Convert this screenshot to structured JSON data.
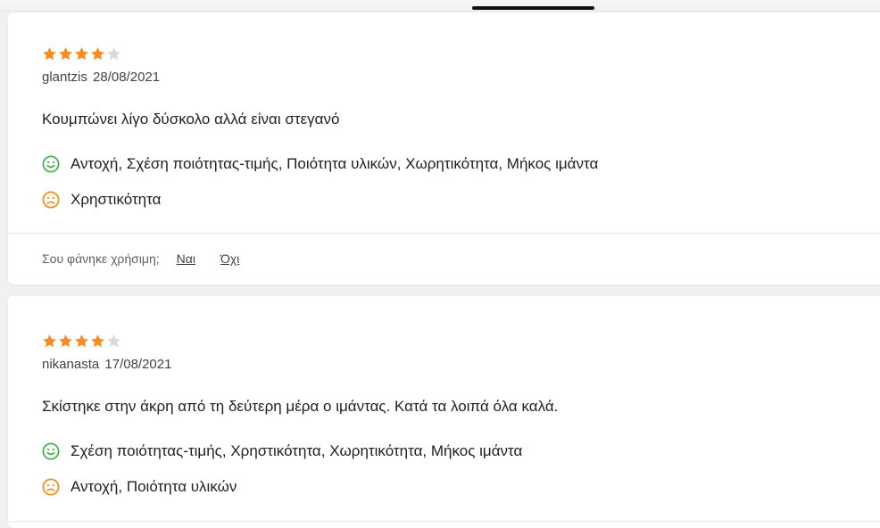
{
  "colors": {
    "star_filled": "#f68b1e",
    "star_empty": "#dadada",
    "positive": "#4caf50",
    "negative": "#f68b1e"
  },
  "reviews": [
    {
      "rating": 4,
      "max_rating": 5,
      "author": "glantzis",
      "date": "28/08/2021",
      "text": "Κουμπώνει λίγο δύσκολο αλλά είναι στεγανό",
      "pros_icon": "smile-icon",
      "pros": "Αντοχή, Σχέση ποιότητας-τιμής, Ποιότητα υλικών, Χωρητικότητα, Μήκος ιμάντα",
      "cons_icon": "frown-icon",
      "cons": "Χρηστικότητα",
      "helpful": {
        "question": "Σου φάνηκε χρήσιμη;",
        "yes": "Ναι",
        "no": "Όχι"
      }
    },
    {
      "rating": 4,
      "max_rating": 5,
      "author": "nikanasta",
      "date": "17/08/2021",
      "text": "Σκίστηκε στην άκρη από τη δεύτερη μέρα ο ιμάντας. Κατά τα λοιπά όλα καλά.",
      "pros_icon": "smile-icon",
      "pros": "Σχέση ποιότητας-τιμής, Χρηστικότητα, Χωρητικότητα, Μήκος ιμάντα",
      "cons_icon": "frown-icon",
      "cons": "Αντοχή, Ποιότητα υλικών"
    }
  ]
}
